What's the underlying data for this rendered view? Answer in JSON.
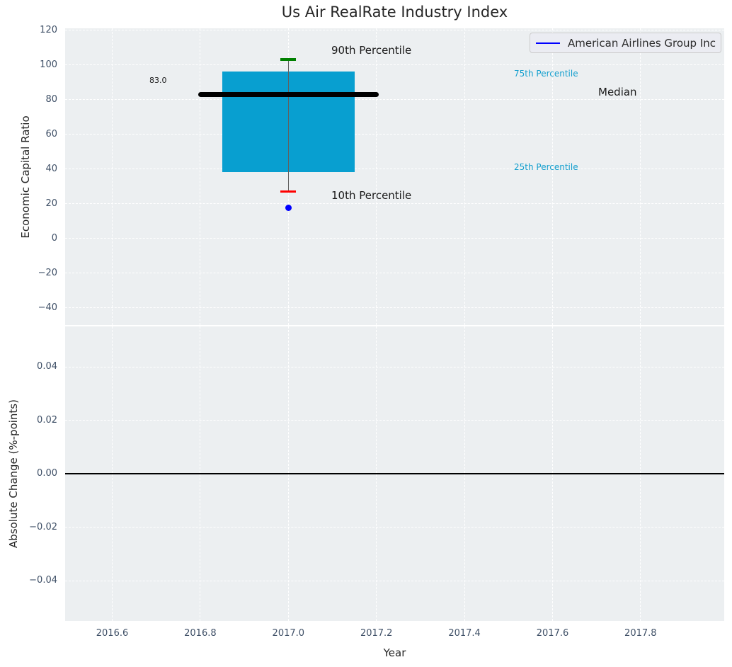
{
  "title": "Us Air RealRate Industry Index",
  "legend": {
    "label": "American Airlines Group Inc",
    "line_color": "#0000ff"
  },
  "colors": {
    "figure_bg": "#ffffff",
    "axes_bg": "#eceff1",
    "grid": "#ffffff",
    "tick_label": "#3e4f66",
    "text": "#262626",
    "box_fill": "#089fd0",
    "whisker": "#606060",
    "cap_90": "#008000",
    "cap_10": "#ff0000",
    "median_line": "#000000",
    "company_dot": "#0000ff",
    "percentile_label": "#149fce",
    "zero_line": "#000000"
  },
  "chart_data": [
    {
      "type": "box",
      "title": "Us Air RealRate Industry Index",
      "ylabel": "Economic Capital Ratio",
      "xlim": [
        2016.493,
        2017.99
      ],
      "ylim": [
        -50,
        121
      ],
      "yticks": [
        120,
        100,
        80,
        60,
        40,
        20,
        0,
        -20,
        -40
      ],
      "ytick_labels": [
        "120",
        "100",
        "80",
        "60",
        "40",
        "20",
        "0",
        "−20",
        "−40"
      ],
      "xticks": [
        2016.6,
        2016.8,
        2017.0,
        2017.2,
        2017.4,
        2017.6,
        2017.8
      ],
      "grid": "dashed-white",
      "legend_position": "upper right",
      "box": {
        "x0": 2016.85,
        "x1": 2017.15,
        "q1": 38,
        "q3": 96
      },
      "whisker": {
        "x": 2017.0,
        "low": 27,
        "high": 103
      },
      "median": {
        "value": 83.0,
        "x0": 2016.8,
        "x1": 2017.2
      },
      "company_point": {
        "x": 2017.0,
        "y": 17.5
      },
      "percentiles": {
        "p90": 103,
        "p75": 96,
        "median": 83.0,
        "p25": 38,
        "p10": 27
      },
      "labels": {
        "p90": "90th Percentile",
        "p75": "75th Percentile",
        "median": "Median",
        "p25": "25th Percentile",
        "p10": "10th Percentile",
        "median_value": "83.0"
      }
    },
    {
      "type": "line",
      "ylabel": "Absolute Change (%-points)",
      "xlabel": "Year",
      "xlim": [
        2016.493,
        2017.99
      ],
      "ylim": [
        -0.0551,
        0.0551
      ],
      "yticks": [
        0.04,
        0.02,
        0,
        -0.02,
        -0.04
      ],
      "ytick_labels": [
        "0.04",
        "0.02",
        "0.00",
        "−0.02",
        "−0.04"
      ],
      "xticks": [
        2016.6,
        2016.8,
        2017.0,
        2017.2,
        2017.4,
        2017.6,
        2017.8
      ],
      "xtick_labels": [
        "2016.6",
        "2016.8",
        "2017.0",
        "2017.2",
        "2017.4",
        "2017.6",
        "2017.8"
      ],
      "grid": "dashed-white",
      "zero_line": 0.0
    }
  ]
}
